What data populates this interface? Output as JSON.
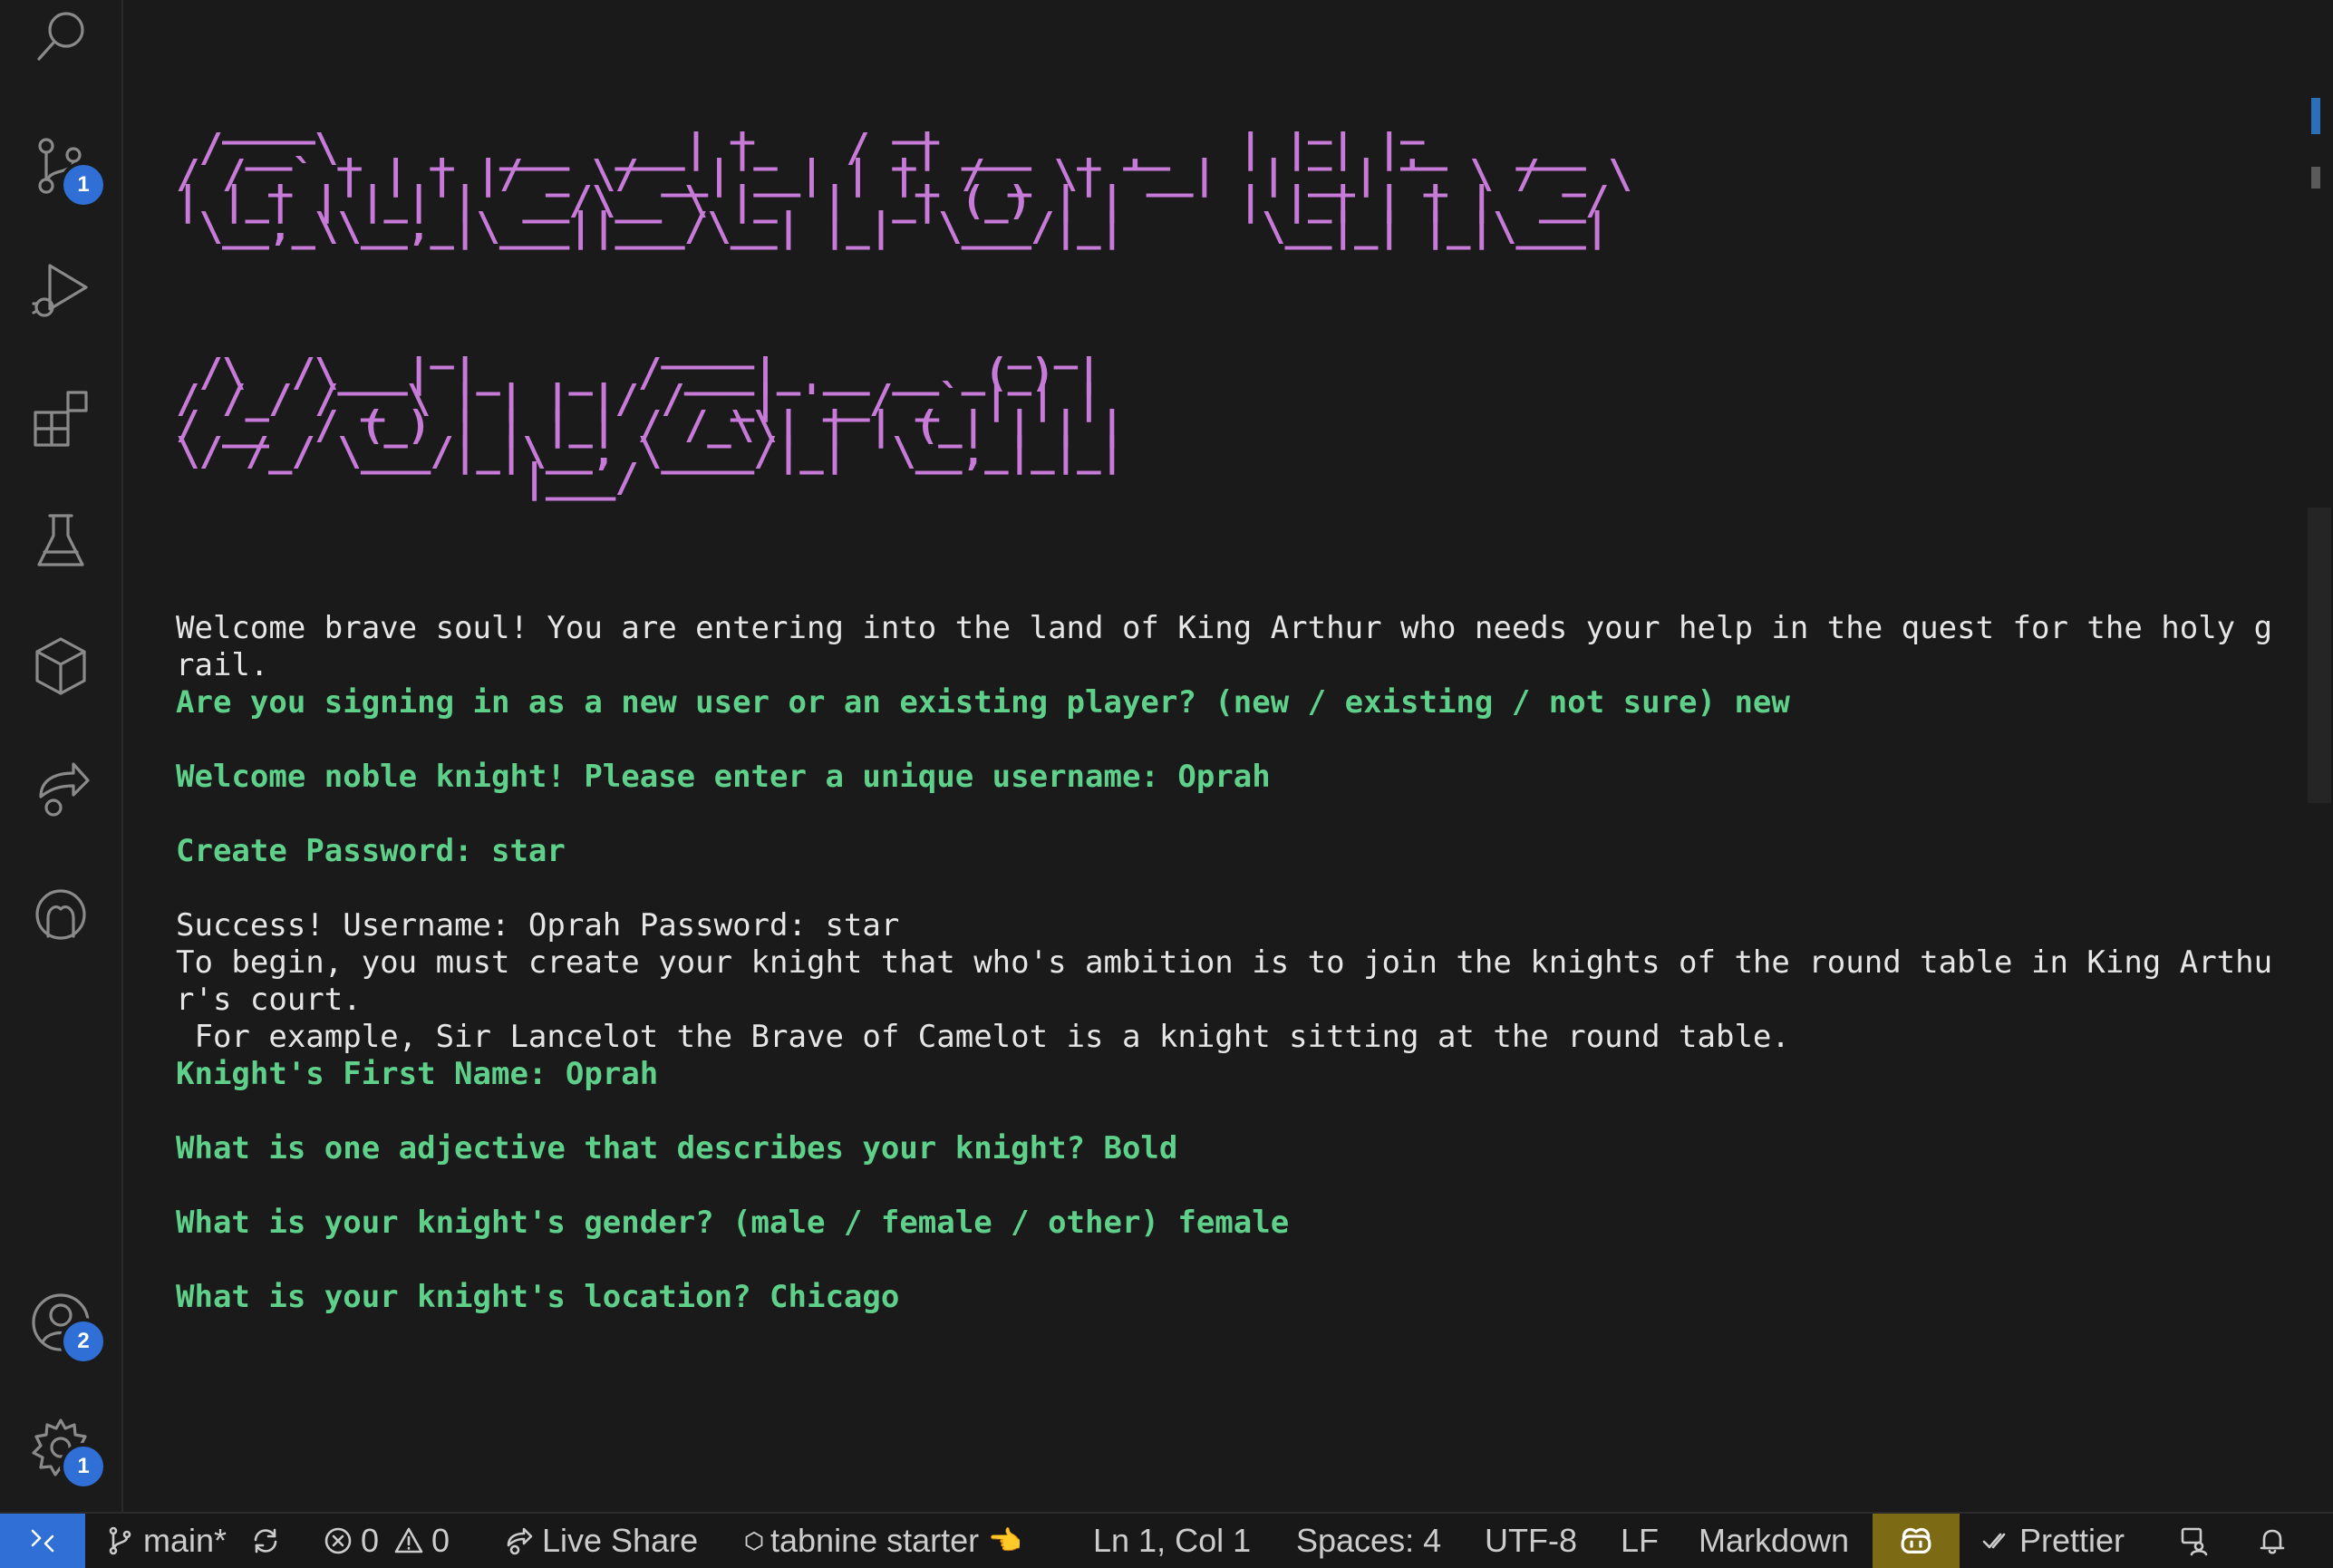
{
  "activity_bar": {
    "icons": [
      "search-icon",
      "source-control-icon",
      "run-debug-icon",
      "extensions-icon",
      "testing-icon",
      "remote-explorer-icon",
      "live-share-icon",
      "github-copilot-icon",
      "accounts-icon",
      "settings-gear-icon"
    ],
    "source_control_badge": "1",
    "accounts_badge": "2",
    "settings_badge": "1"
  },
  "editor": {
    "ascii_title_1": "  ____                  _      __                _   _\n / __ \\_   _  ___  ___| |_   / _| ___  _ __   | |_| |__   ___\n/ / _` | | | |/ _ \\/ __| __| | |_ / _ \\| '__|  | __| '_ \\ / _ \\\n| |_| | |_| |  __/\\__ \\ |_  |  _| (_) | |     | |_| | | |  __/\n \\__,_\\\\__,_|\\___||___/\\__| |_|  \\___/|_|      \\__|_| |_|\\___|",
    "ascii_title_2": "           _         ____           _ _\n /\\  /\\___| |_   _  / ___|_ __ __ _(_) |\n/ /_/ / _ \\ | | | |/ /  _| '__/ _` | | |\n/ __  / (_) | | |_| / /_\\\\| | | (_| | | |\n\\/ /_/ \\___/|_|\\__, \\____/|_|  \\__,_|_|_|\n               |___/",
    "console_lines": [
      {
        "text": "Welcome brave soul! You are entering into the land of King Arthur who needs your help in the quest for the holy g",
        "style": "plain"
      },
      {
        "text": "rail.",
        "style": "plain"
      },
      {
        "text": "Are you signing in as a new user or an existing player? (new / existing / not sure) new",
        "style": "prompt"
      },
      {
        "text": "",
        "style": "plain"
      },
      {
        "text": "Welcome noble knight! Please enter a unique username: Oprah",
        "style": "prompt"
      },
      {
        "text": "",
        "style": "plain"
      },
      {
        "text": "Create Password: star",
        "style": "prompt"
      },
      {
        "text": "",
        "style": "plain"
      },
      {
        "text": "Success! Username: Oprah Password: star",
        "style": "plain"
      },
      {
        "text": "To begin, you must create your knight that who's ambition is to join the knights of the round table in King Arthu",
        "style": "plain"
      },
      {
        "text": "r's court.",
        "style": "plain"
      },
      {
        "text": " For example, Sir Lancelot the Brave of Camelot is a knight sitting at the round table.",
        "style": "plain"
      },
      {
        "text": "Knight's First Name: Oprah",
        "style": "prompt"
      },
      {
        "text": "",
        "style": "plain"
      },
      {
        "text": "What is one adjective that describes your knight? Bold",
        "style": "prompt"
      },
      {
        "text": "",
        "style": "plain"
      },
      {
        "text": "What is your knight's gender? (male / female / other) female",
        "style": "prompt"
      },
      {
        "text": "",
        "style": "plain"
      },
      {
        "text": "What is your knight's location? Chicago",
        "style": "prompt"
      }
    ]
  },
  "status_bar": {
    "branch": "main*",
    "errors": "0",
    "warnings": "0",
    "live_share": "Live Share",
    "tabnine": "tabnine starter",
    "tabnine_emoji": "👈",
    "cursor_position": "Ln 1, Col 1",
    "indentation": "Spaces: 4",
    "encoding": "UTF-8",
    "eol": "LF",
    "language": "Markdown",
    "prettier": "Prettier"
  },
  "colors": {
    "background": "#1a1a1a",
    "ascii_art": "#c77ad7",
    "prompt_text": "#5fd08a",
    "plain_text": "#e6e6e6",
    "badge": "#2f6fd6",
    "remote_indicator": "#2f6fd6",
    "copilot_indicator": "#7d6a15"
  }
}
